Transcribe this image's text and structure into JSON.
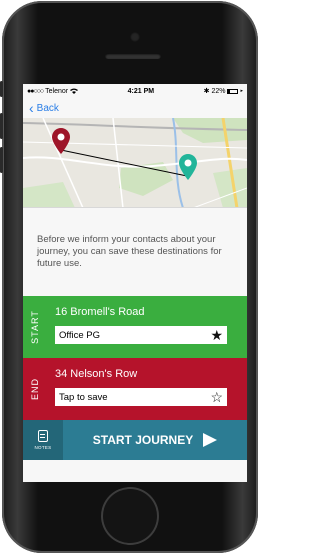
{
  "statusbar": {
    "signal": "●●○○○",
    "carrier": "Telenor",
    "time": "4:21 PM",
    "battery": "22%"
  },
  "nav": {
    "back_label": "Back"
  },
  "info_text": "Before we inform your contacts about your journey, you can save these destinations for future use.",
  "start": {
    "side_label": "START",
    "address": "16 Bromell's Road",
    "saved_name": "Office PG",
    "saved": true
  },
  "end": {
    "side_label": "END",
    "address": "34 Nelson's Row",
    "saved_name": "Tap to save",
    "saved": false
  },
  "footer": {
    "notes_label": "NOTES",
    "start_button": "START JOURNEY"
  },
  "colors": {
    "start": "#3aae3f",
    "end": "#b5132b",
    "footer": "#2c7c93",
    "link": "#2a7ee6"
  }
}
